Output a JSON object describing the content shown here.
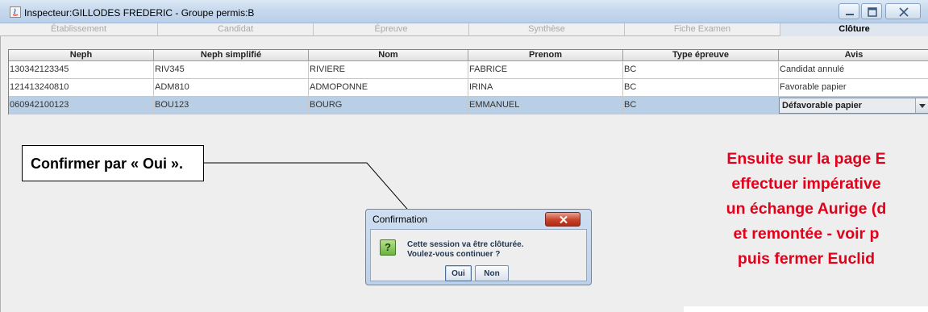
{
  "window": {
    "title": "Inspecteur:GILLODES FREDERIC - Groupe permis:B",
    "buttons": [
      "minimize-icon",
      "maximize-icon",
      "close-icon"
    ]
  },
  "tabs": [
    {
      "label": "Établissement",
      "active": false
    },
    {
      "label": "Candidat",
      "active": false
    },
    {
      "label": "Épreuve",
      "active": false
    },
    {
      "label": "Synthèse",
      "active": false
    },
    {
      "label": "Fiche Examen",
      "active": false
    },
    {
      "label": "Clôture",
      "active": true
    }
  ],
  "table": {
    "columns": [
      "Neph",
      "Neph simplifié",
      "Nom",
      "Prenom",
      "Type épreuve",
      "Avis"
    ],
    "rows": [
      [
        "130342123345",
        "RIV345",
        "RIVIERE",
        "FABRICE",
        "BC",
        "Candidat annulé"
      ],
      [
        "121413240810",
        "ADM810",
        "ADMOPONNE",
        "IRINA",
        "BC",
        "Favorable papier"
      ],
      [
        "060942100123",
        "BOU123",
        "BOURG",
        "EMMANUEL",
        "BC",
        "Défavorable papier"
      ]
    ],
    "selected_row": 2
  },
  "callout": {
    "text": "Confirmer par « Oui »."
  },
  "annotation": {
    "lines": [
      "Ensuite sur la page E",
      "effectuer impérative",
      "un échange Aurige (d",
      "et remontée - voir p",
      "puis fermer Euclid"
    ],
    "color": "#e2001a"
  },
  "dialog": {
    "title": "Confirmation",
    "message_line1": "Cette session va être clôturée.",
    "message_line2": "Voulez-vous continuer ?",
    "ok_label": "Oui",
    "no_label": "Non",
    "icon": "question-icon"
  },
  "colors": {
    "selected_row": "#b8cfe5",
    "panel": "#eeeeee",
    "title_bar": "#c7d9ee"
  }
}
